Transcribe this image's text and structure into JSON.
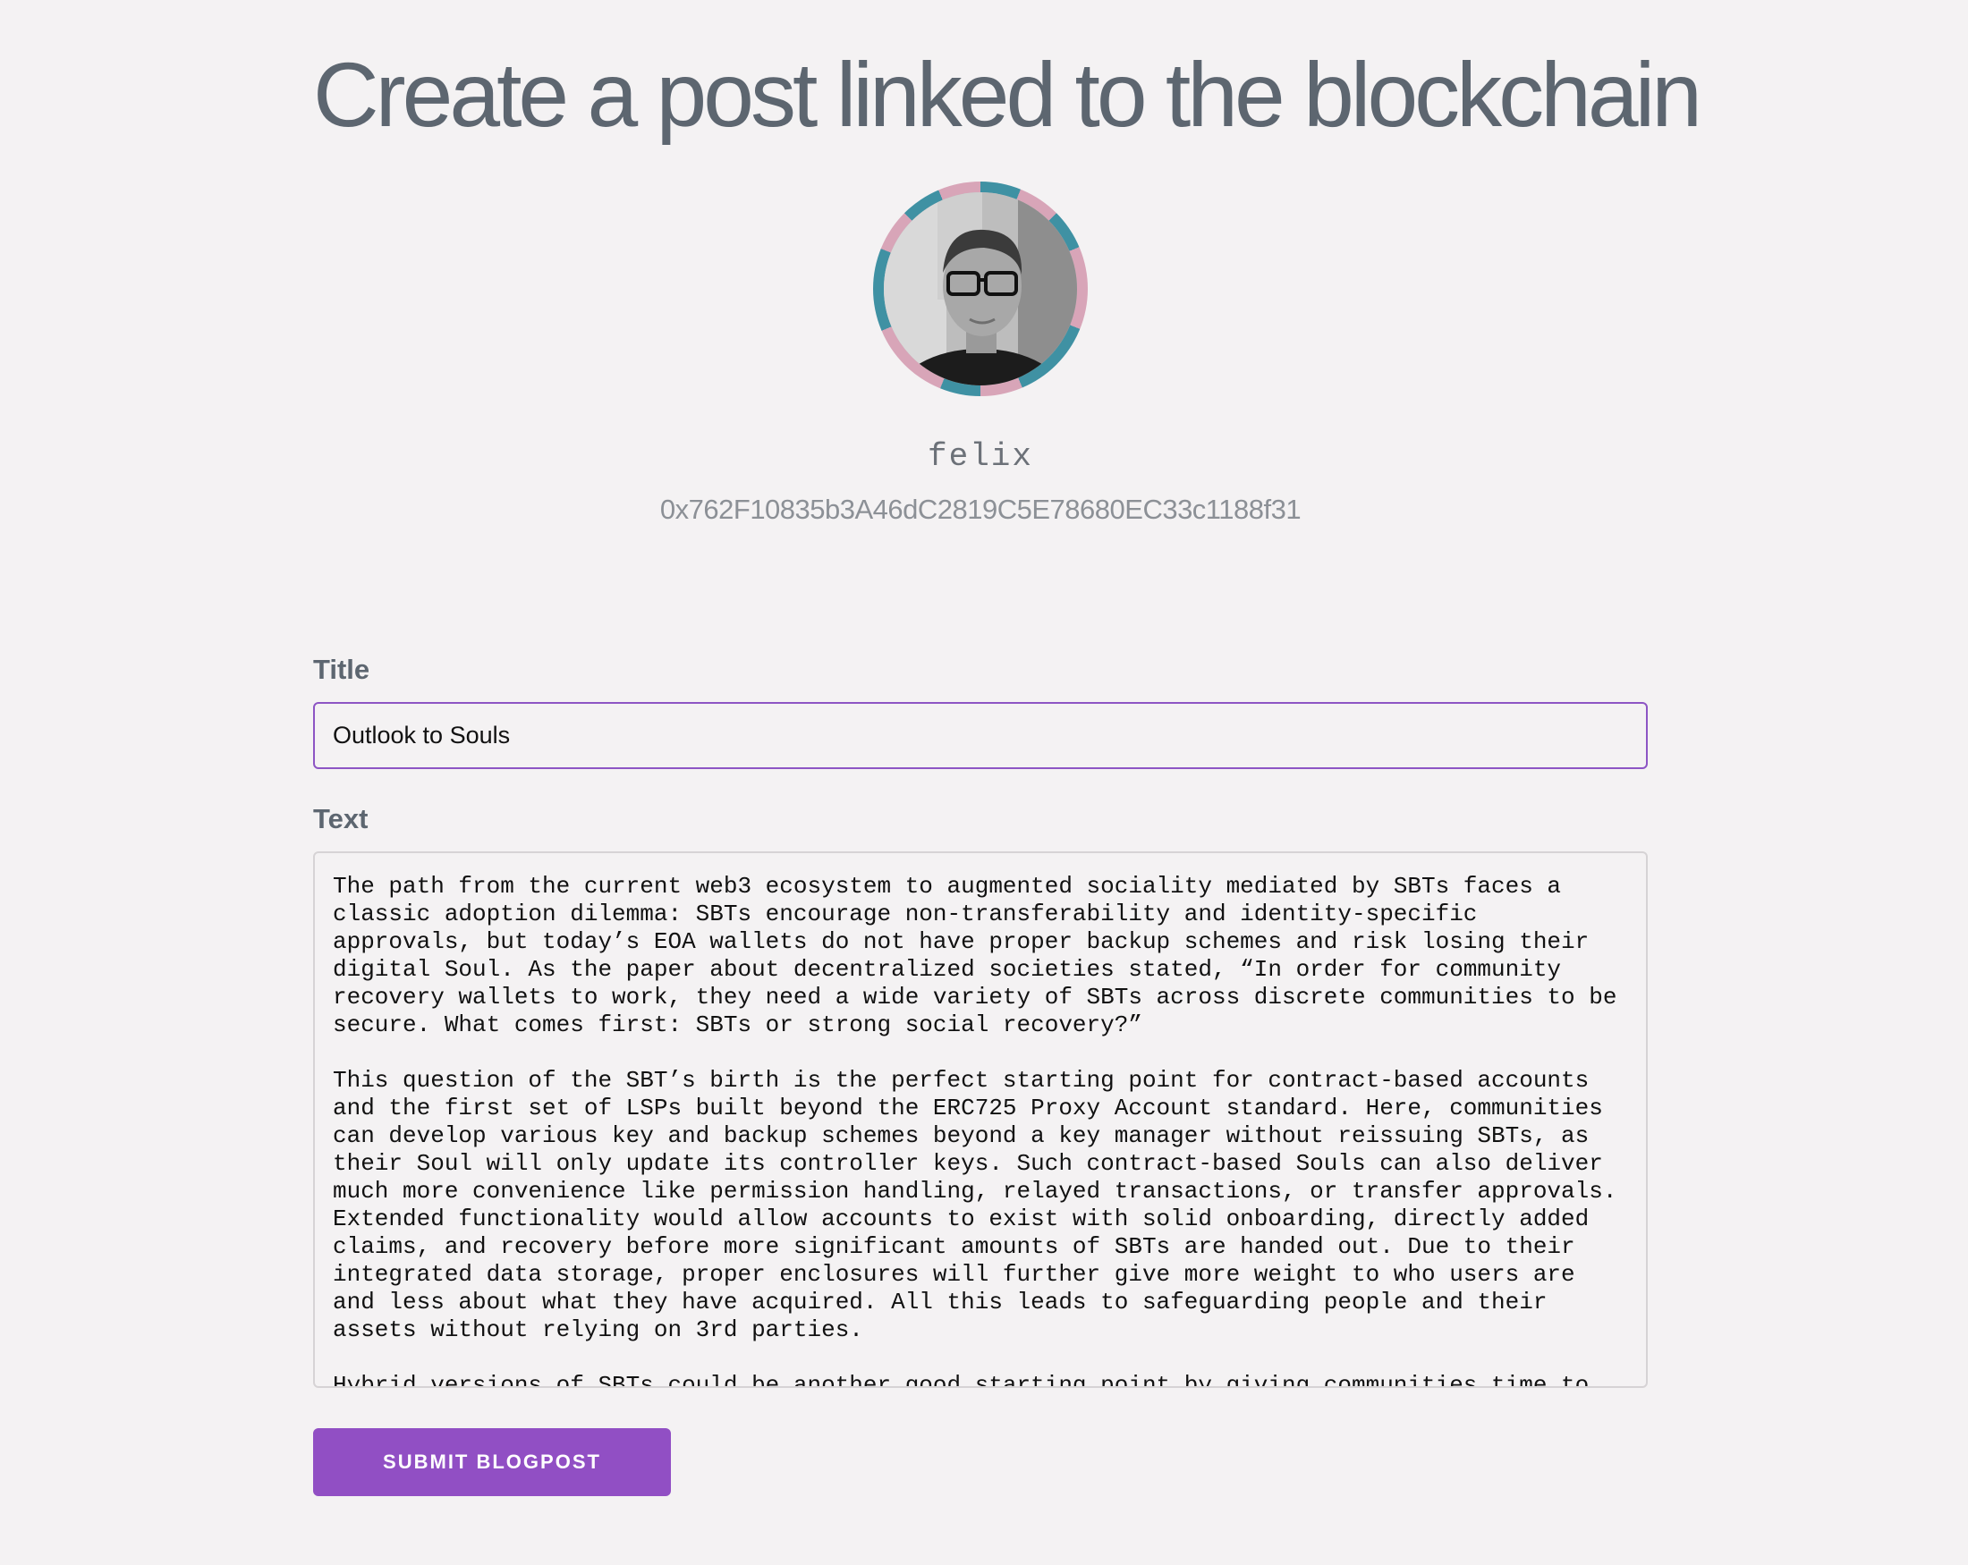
{
  "page": {
    "title": "Create a post linked to the blockchain"
  },
  "profile": {
    "name": "felix",
    "address": "0x762F10835b3A46dC2819C5E78680EC33c1188f31",
    "ring_colors": [
      "#3f91a3",
      "#d8a5b8"
    ]
  },
  "form": {
    "title_label": "Title",
    "title_value": "Outlook to Souls",
    "text_label": "Text",
    "text_value": "The path from the current web3 ecosystem to augmented sociality mediated by SBTs faces a classic adoption dilemma: SBTs encourage non-transferability and identity-specific approvals, but today’s EOA wallets do not have proper backup schemes and risk losing their digital Soul. As the paper about decentralized societies stated, “In order for community recovery wallets to work, they need a wide variety of SBTs across discrete communities to be secure. What comes first: SBTs or strong social recovery?”\n\nThis question of the SBT’s birth is the perfect starting point for contract-based accounts and the first set of LSPs built beyond the ERC725 Proxy Account standard. Here, communities can develop various key and backup schemes beyond a key manager without reissuing SBTs, as their Soul will only update its controller keys. Such contract-based Souls can also deliver much more convenience like permission handling, relayed transactions, or transfer approvals. Extended functionality would allow accounts to exist with solid onboarding, directly added claims, and recovery before more significant amounts of SBTs are handed out. Due to their integrated data storage, proper enclosures will further give more weight to who users are and less about what they have acquired. All this leads to safeguarding people and their assets without relying on 3rd parties.\n\nHybrid versions of SBTs could be another good starting point by giving communities time to",
    "submit_label": "SUBMIT BLOGPOST"
  },
  "colors": {
    "background": "#f4f2f3",
    "accent": "#914fc4",
    "heading": "#5d6670"
  }
}
